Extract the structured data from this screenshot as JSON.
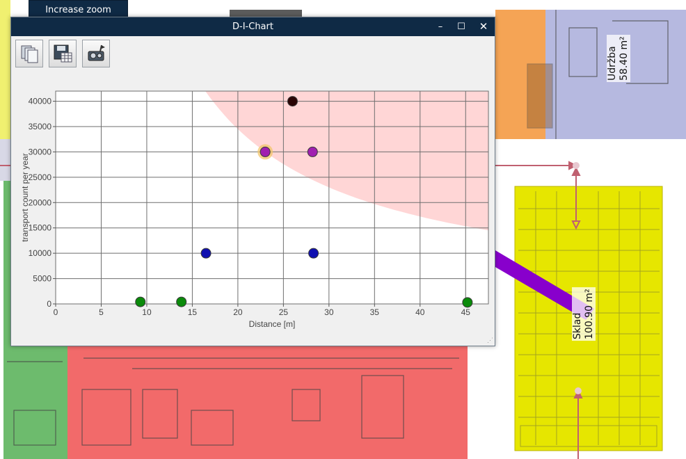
{
  "zoom_button": {
    "label": "Increase zoom"
  },
  "floorplan": {
    "rooms": [
      {
        "name": "Udržba",
        "area": "58.40 m²",
        "color": "#b6b9e0"
      },
      {
        "name": "Sklad",
        "area": "100.90 m²",
        "color": "#e6e600"
      }
    ],
    "zone_colors": {
      "red": "#f26a6a",
      "yellow": "#f0f070",
      "green": "#6dbb6d",
      "orange": "#f5a455",
      "path": "#8800cc",
      "arrow": "#c06070"
    }
  },
  "window": {
    "title": "D-I-Chart",
    "controls": {
      "minimize": "–",
      "maximize": "☐",
      "close": "✕"
    },
    "toolbar": [
      {
        "icon": "copy-pages-icon"
      },
      {
        "icon": "save-table-icon"
      },
      {
        "icon": "export-media-icon"
      }
    ]
  },
  "chart_data": {
    "type": "scatter",
    "xlabel": "Distance [m]",
    "ylabel": "transport count per year",
    "xlim": [
      0,
      47.5
    ],
    "ylim": [
      0,
      42000
    ],
    "xticks": [
      0,
      5,
      10,
      15,
      20,
      25,
      30,
      35,
      40,
      45
    ],
    "yticks": [
      0,
      5000,
      10000,
      15000,
      20000,
      25000,
      30000,
      35000,
      40000
    ],
    "grid": true,
    "critical_region": {
      "color": "#ffd6d6",
      "boundary": "x * y = 690000"
    },
    "points": [
      {
        "x": 9.3,
        "y": 400,
        "color": "#0a8a0a"
      },
      {
        "x": 13.8,
        "y": 400,
        "color": "#0a8a0a"
      },
      {
        "x": 45.2,
        "y": 300,
        "color": "#0a8a0a"
      },
      {
        "x": 16.5,
        "y": 10000,
        "color": "#1010b0"
      },
      {
        "x": 28.3,
        "y": 10000,
        "color": "#1010b0"
      },
      {
        "x": 23.0,
        "y": 30000,
        "color": "#a020b0",
        "highlighted": true
      },
      {
        "x": 28.2,
        "y": 30000,
        "color": "#a020b0"
      },
      {
        "x": 26.0,
        "y": 40000,
        "color": "#2a0505"
      }
    ]
  }
}
